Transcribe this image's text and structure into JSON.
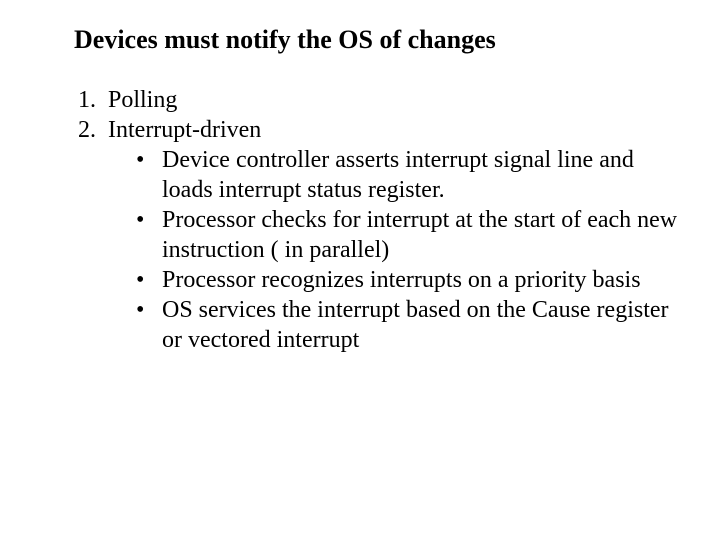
{
  "title": "Devices must notify the OS of changes",
  "items": [
    {
      "label": "Polling"
    },
    {
      "label": "Interrupt-driven",
      "sub": [
        "Device controller asserts interrupt signal line and loads interrupt status register.",
        "Processor checks for interrupt at the start of each new instruction ( in parallel)",
        "Processor recognizes interrupts on a priority basis",
        "OS services the interrupt based on the Cause register or vectored interrupt"
      ]
    }
  ]
}
